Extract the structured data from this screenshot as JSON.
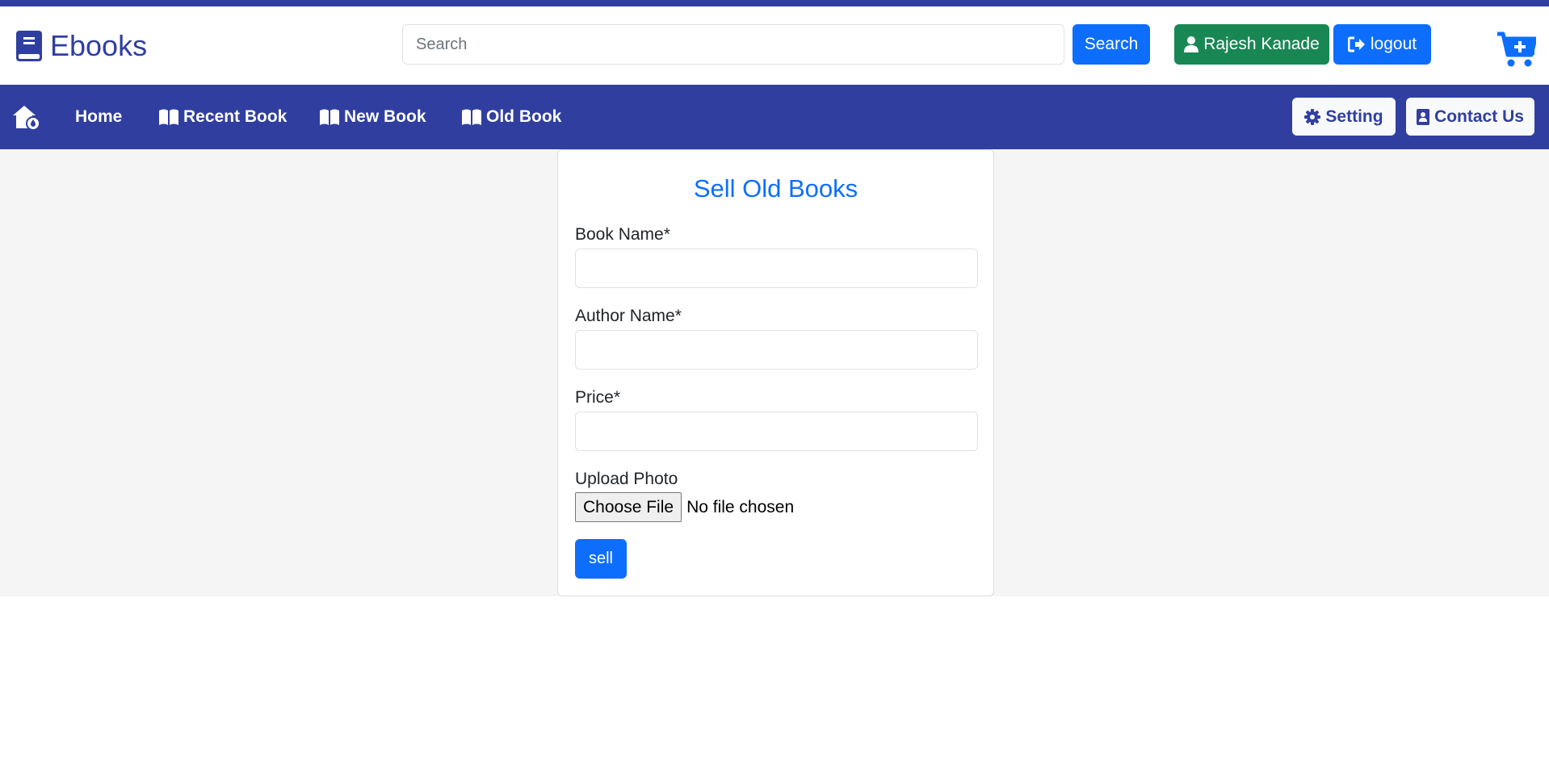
{
  "brand": {
    "name": "Ebooks",
    "icon": "book-icon"
  },
  "header": {
    "search_placeholder": "Search",
    "search_label": "Search",
    "user_label": "Rajesh Kanade",
    "logout_label": "logout",
    "cart_icon": "cart-plus-icon"
  },
  "nav": {
    "home_icon": "house-icon",
    "links": [
      {
        "label": "Home"
      },
      {
        "label": "Recent Book",
        "icon": "open-book-icon"
      },
      {
        "label": "New Book",
        "icon": "open-book-icon"
      },
      {
        "label": "Old Book",
        "icon": "open-book-icon"
      }
    ],
    "setting_label": "Setting",
    "contact_label": "Contact Us"
  },
  "form": {
    "title": "Sell Old Books",
    "book_name_label": "Book Name*",
    "author_name_label": "Author Name*",
    "price_label": "Price*",
    "upload_label": "Upload Photo",
    "choose_file_label": "Choose File",
    "file_status": "No file chosen",
    "submit_label": "sell"
  },
  "colors": {
    "brand": "#303f9f",
    "primary": "#0d6efd",
    "success": "#198754"
  }
}
